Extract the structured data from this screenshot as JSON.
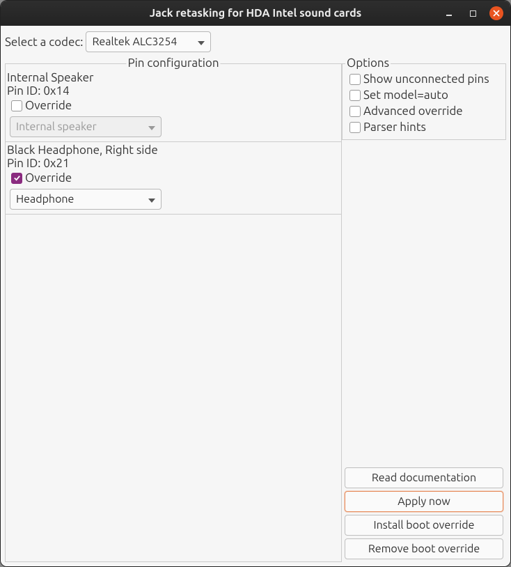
{
  "window": {
    "title": "Jack retasking for HDA Intel sound cards"
  },
  "codec": {
    "label": "Select a codec:",
    "selected": "Realtek ALC3254"
  },
  "pin_config": {
    "legend": "Pin configuration",
    "pins": [
      {
        "name": "Internal Speaker",
        "pin_id_label": "Pin ID: 0x14",
        "override_label": "Override",
        "override_checked": false,
        "combo_value": "Internal speaker",
        "combo_enabled": false
      },
      {
        "name": "Black Headphone, Right side",
        "pin_id_label": "Pin ID: 0x21",
        "override_label": "Override",
        "override_checked": true,
        "combo_value": "Headphone",
        "combo_enabled": true
      }
    ]
  },
  "options": {
    "legend": "Options",
    "items": [
      {
        "label": "Show unconnected pins",
        "checked": false
      },
      {
        "label": "Set model=auto",
        "checked": false
      },
      {
        "label": "Advanced override",
        "checked": false
      },
      {
        "label": "Parser hints",
        "checked": false
      }
    ]
  },
  "buttons": {
    "read_doc": "Read documentation",
    "apply_now": "Apply now",
    "install_boot": "Install boot override",
    "remove_boot": "Remove boot override"
  }
}
